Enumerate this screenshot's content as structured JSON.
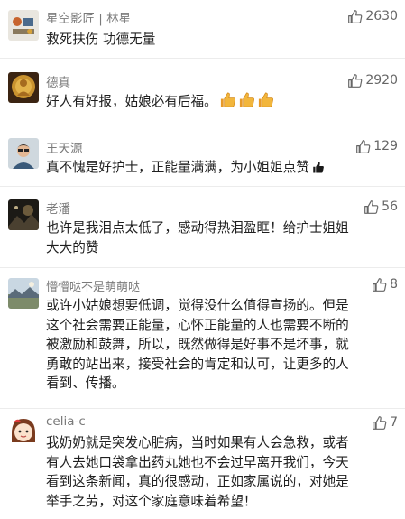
{
  "comments": [
    {
      "name": "星空影匠 | 林星",
      "likes": "2630",
      "lines": [
        "救死扶伤 功德无量"
      ],
      "avatar": "avatar-shapes",
      "emoji": []
    },
    {
      "name": "德真",
      "likes": "2920",
      "lines": [
        "好人有好报，姑娘必有后福。"
      ],
      "avatar": "buddha-statue",
      "emoji": [
        "thumbs-up-emoji",
        "thumbs-up-emoji",
        "thumbs-up-emoji"
      ]
    },
    {
      "name": "王天源",
      "likes": "129",
      "lines": [
        "真不愧是好护士，正能量满满，为小姐姐点赞"
      ],
      "avatar": "person-photo",
      "emoji": [
        "thumbs-up-black-emoji"
      ]
    },
    {
      "name": "老潘",
      "likes": "56",
      "lines": [
        "也许是我泪点太低了，感动得热泪盈眶！给护士姐姐",
        "大大的赞"
      ],
      "avatar": "dark-photo",
      "emoji": []
    },
    {
      "name": "懵懵哒不是萌萌哒",
      "likes": "8",
      "lines": [
        "或许小姑娘想要低调，觉得没什么值得宣扬的。但是",
        "这个社会需要正能量，心怀正能量的人也需要不断的",
        "被激励和鼓舞，所以，既然做得是好事不是坏事，就",
        "勇敢的站出来，接受社会的肯定和认可，让更多的人",
        "看到、传播。"
      ],
      "avatar": "landscape-photo",
      "emoji": []
    },
    {
      "name": "celia-c",
      "likes": "7",
      "lines": [
        "我奶奶就是突发心脏病，当时如果有人会急救，或者",
        "有人去她口袋拿出药丸她也不会过早离开我们，今天",
        "看到这条新闻，真的很感动，正如家属说的，对她是",
        "举手之劳，对这个家庭意味着希望！"
      ],
      "avatar": "cartoon-girl",
      "emoji": []
    }
  ],
  "colors": {
    "name": "#7a7a7a",
    "text": "#1f1f1f",
    "like": "#666666",
    "divider": "#ececec",
    "emoji_yellow": "#f2b63c"
  }
}
